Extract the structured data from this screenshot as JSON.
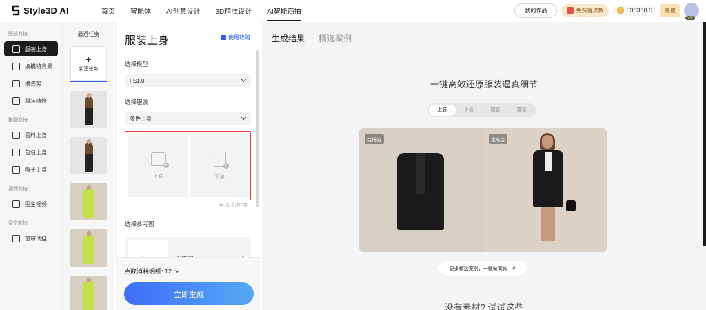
{
  "app": {
    "logo_text": "Style3D AI"
  },
  "nav": {
    "items": [
      "首页",
      "智能体",
      "AI创意设计",
      "3D精准设计",
      "AI智能商拍"
    ],
    "active_index": 4
  },
  "topbar": {
    "my_works": "我的作品",
    "free_points": "免费得点数",
    "credits": "538380.5",
    "recharge": "充值",
    "vip_badge": "VIP"
  },
  "sidebar": {
    "sections": [
      {
        "title": "服装商拍",
        "items": [
          "服装上身",
          "换模特背景",
          "换姿势",
          "服装精修"
        ]
      },
      {
        "title": "搭配商拍",
        "items": [
          "面料上身",
          "包包上身",
          "帽子上身"
        ]
      },
      {
        "title": "视频商拍",
        "items": [
          "图生视频"
        ]
      },
      {
        "title": "窗帘商拍",
        "items": [
          "窗帘试挂"
        ]
      }
    ],
    "active_item": "服装上身"
  },
  "history": {
    "title": "最近任务",
    "new_task_plus": "+",
    "new_task_label": "新建任务"
  },
  "form": {
    "title": "服装上身",
    "guide_link": "使用攻略",
    "model_label": "选择模型",
    "model_value": "FS1.0",
    "garment_label": "选择服装",
    "garment_mode": "多件上身",
    "top_slot": "上装",
    "bottom_slot": "下装",
    "swap": "⇆ 左右切换",
    "reference_label": "选择参考图",
    "reference_value": "未选择",
    "points_detail": "点数消耗明细: 12",
    "generate_button": "立即生成"
  },
  "main": {
    "tabs": [
      "生成结果",
      "精选案例"
    ],
    "headline": "一键高效还原服装逼真细节",
    "segments": [
      "上装",
      "下装",
      "裙装",
      "套装"
    ],
    "active_segment": 0,
    "before_tag": "生成前",
    "after_tag": "生成后",
    "more_cases": "更多精选案例，一键做同款",
    "more_cases_icon": "↗",
    "bottom_hint": "没有素材? 试试这些"
  },
  "colors": {
    "accent": "#2c5cf6",
    "highlight_border": "#e33333",
    "active_dark": "#1c1c1c"
  }
}
